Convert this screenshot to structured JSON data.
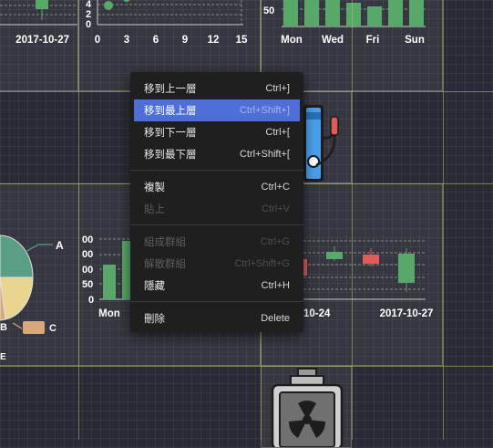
{
  "context_menu": {
    "items": [
      {
        "label": "移到上一層",
        "shortcut": "Ctrl+]"
      },
      {
        "label": "移到最上層",
        "shortcut": "Ctrl+Shift+]"
      },
      {
        "label": "移到下一層",
        "shortcut": "Ctrl+["
      },
      {
        "label": "移到最下層",
        "shortcut": "Ctrl+Shift+["
      },
      {
        "label": "複製",
        "shortcut": "Ctrl+C"
      },
      {
        "label": "貼上",
        "shortcut": "Ctrl+V"
      },
      {
        "label": "組成群組",
        "shortcut": "Ctrl+G"
      },
      {
        "label": "解散群組",
        "shortcut": "Ctrl+Shift+G"
      },
      {
        "label": "隱藏",
        "shortcut": "Ctrl+H"
      },
      {
        "label": "刪除",
        "shortcut": "Delete"
      }
    ]
  },
  "widgets": {
    "candle_top": {
      "date_label": "2017-10-27"
    },
    "scatter": {
      "x_ticks": [
        "0",
        "3",
        "6",
        "9",
        "12",
        "15"
      ],
      "y_ticks": [
        "4",
        "2",
        "0"
      ]
    },
    "weekday_bar": {
      "y_tick": "50",
      "x_ticks": [
        "Mon",
        "Wed",
        "Fri",
        "Sun"
      ]
    },
    "pie": {
      "labels": [
        "A",
        "B",
        "C",
        "E"
      ]
    },
    "bar_mid": {
      "y_ticks": [
        "00",
        "00",
        "00",
        "50",
        "0"
      ],
      "x_tick": "Mon"
    },
    "candle_mid": {
      "x_ticks": [
        "10-24",
        "2017-10-27"
      ]
    }
  },
  "colors": {
    "green": "#58a86a",
    "red": "#e05a5a",
    "menu_bg": "#1f1f1f",
    "menu_highlight": "#4f6fd8",
    "pie_green": "#5a9e86",
    "pie_yellow": "#e9d58f",
    "pie_tan": "#d7a97a"
  }
}
